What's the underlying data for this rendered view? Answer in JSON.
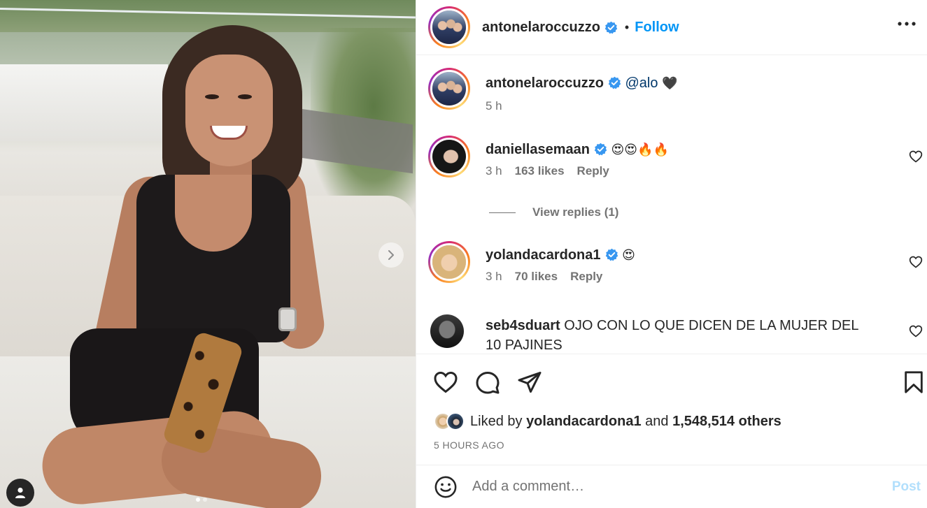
{
  "post": {
    "author": "antonelaroccuzzo",
    "separator": "•",
    "follow_label": "Follow",
    "carousel": {
      "total_slides": 2,
      "current_slide": 1
    }
  },
  "caption": {
    "user": "antonelaroccuzzo",
    "mention": "@alo",
    "emoji": "🖤",
    "time": "5 h"
  },
  "comments": [
    {
      "user": "daniellasemaan",
      "text": "😍😍🔥🔥",
      "time": "3 h",
      "likes": "163 likes",
      "reply": "Reply"
    },
    {
      "user": "yolandacardona1",
      "text": "😍",
      "time": "3 h",
      "likes": "70 likes",
      "reply": "Reply"
    },
    {
      "user": "seb4sduart",
      "text": "OJO CON LO QUE DICEN DE LA MUJER DEL 10 PAJINES"
    }
  ],
  "view_replies": "View replies (1)",
  "liked_by": {
    "prefix": "Liked by",
    "user": "yolandacardona1",
    "and": "and",
    "others": "1,548,514 others"
  },
  "time_ago": "5 HOURS AGO",
  "add_comment": {
    "placeholder": "Add a comment…",
    "post_label": "Post"
  },
  "colors": {
    "accent": "#0095f6",
    "verified": "#3897f0",
    "post_disabled": "#b2dffc"
  },
  "icons": [
    "chevron-right-icon",
    "user-tag-icon",
    "verified-icon",
    "more-icon",
    "heart-icon",
    "comment-icon",
    "share-icon",
    "bookmark-icon",
    "emoji-icon"
  ]
}
